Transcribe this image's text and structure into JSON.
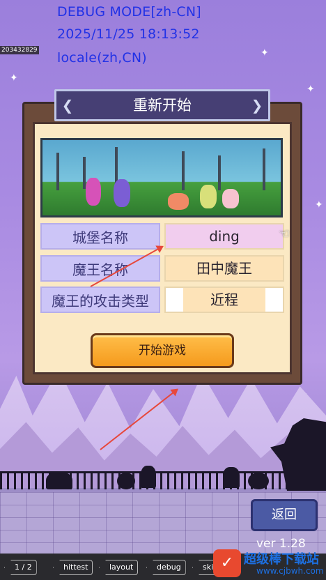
{
  "debug": {
    "mode": "DEBUG MODE[zh-CN]",
    "datetime": "2025/11/25 18:13:52",
    "locale": "locale(zh,CN)",
    "id": "203432829"
  },
  "dialog": {
    "title": "重新开始",
    "fields": [
      {
        "label": "城堡名称",
        "value": "ding",
        "value_bg": "#f1cdee"
      },
      {
        "label": "魔王名称",
        "value": "田中魔王",
        "value_bg": "#fde3b8"
      },
      {
        "label": "魔王的攻击类型",
        "value": "近程",
        "value_bg": "#fde3b8"
      }
    ],
    "start_button": "开始游戏"
  },
  "back_button": "返回",
  "version": "ver 1.28",
  "toolbar": {
    "page": "1 / 2",
    "buttons": [
      "hittest",
      "layout",
      "debug",
      "skip"
    ]
  },
  "watermark": {
    "logo": "✓",
    "title": "超级棒下载站",
    "url": "www.cjbwh.com"
  },
  "colors": {
    "arrow": "#e7483c",
    "title_bar": "#463f74",
    "start_button": "#f59a1c",
    "back_button": "#4b5aa4"
  }
}
